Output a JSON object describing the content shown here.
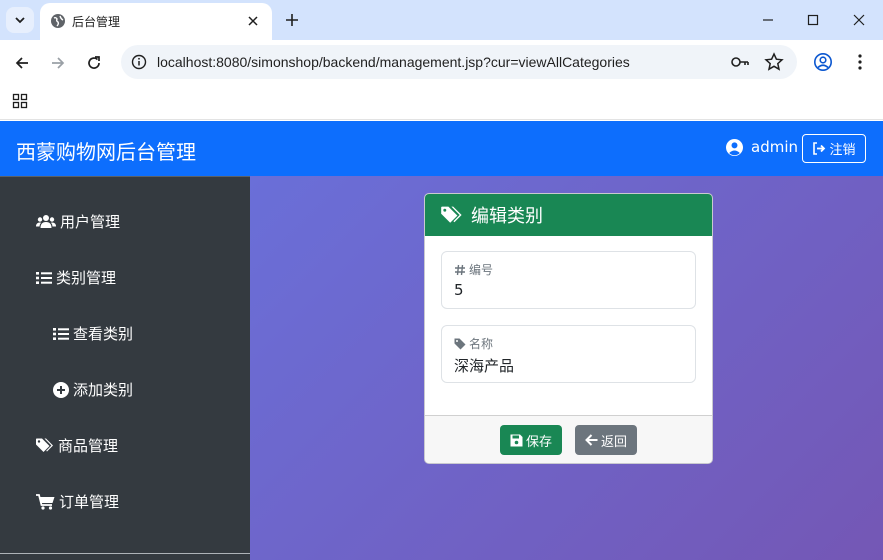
{
  "browser": {
    "tab_title": "后台管理",
    "url": "localhost:8080/simonshop/backend/management.jsp?cur=viewAllCategories"
  },
  "navbar": {
    "brand": "西蒙购物网后台管理",
    "username": "admin",
    "logout_label": "注销"
  },
  "sidebar": {
    "items": [
      {
        "label": "用户管理",
        "icon": "users-icon"
      },
      {
        "label": "类别管理",
        "icon": "list-icon"
      },
      {
        "label": "查看类别",
        "icon": "list-icon"
      },
      {
        "label": "添加类别",
        "icon": "plus-circle-icon"
      },
      {
        "label": "商品管理",
        "icon": "tags-icon"
      },
      {
        "label": "订单管理",
        "icon": "cart-icon"
      }
    ]
  },
  "card": {
    "title": "编辑类别",
    "fields": [
      {
        "label": "编号",
        "value": "5",
        "icon": "hash-icon"
      },
      {
        "label": "名称",
        "value": "深海产品",
        "icon": "tag-icon"
      }
    ],
    "save_label": "保存",
    "back_label": "返回"
  },
  "colors": {
    "navbar": "#0d6efd",
    "sidebar": "#343a40",
    "card_header": "#198754",
    "save_button": "#198754",
    "back_button": "#6c757d",
    "gradient_start": "#6a6fd8",
    "gradient_end": "#7457b5"
  }
}
